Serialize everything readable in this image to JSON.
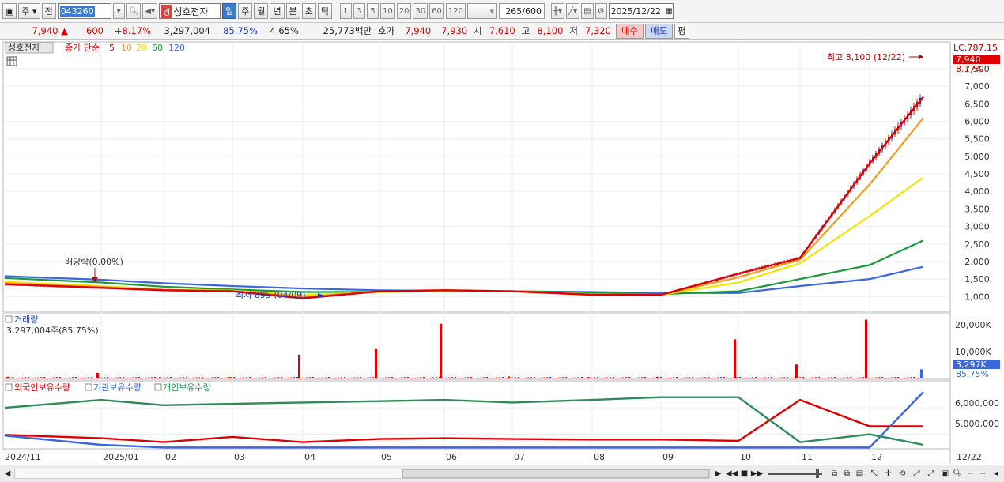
{
  "toolbar": {
    "market": "주",
    "period_type": "전",
    "code": "043260",
    "stock_badge": "경",
    "stock_name": "성호전자",
    "intervals": [
      "일",
      "주",
      "월",
      "년",
      "분",
      "초",
      "틱"
    ],
    "active_interval": "일",
    "ticks": [
      "1",
      "3",
      "5",
      "10",
      "20",
      "30",
      "60",
      "120"
    ],
    "count_value": "265",
    "count_total": "/600",
    "date": "2025/12/22"
  },
  "quote": {
    "price": "7,940",
    "arrow": "▲",
    "change": "600",
    "change_pct": "+8.17%",
    "volume": "3,297,004",
    "vol_ratio": "85.75%",
    "turnover": "4.65%",
    "amount": "25,773백만",
    "ask_label": "호가",
    "ask1": "7,940",
    "ask2": "7,930",
    "open_label": "시",
    "open": "7,610",
    "high_label": "고",
    "high": "8,100",
    "low_label": "저",
    "low": "7,320",
    "buy_label": "매수",
    "sell_label": "매도",
    "even_label": "평"
  },
  "price_panel": {
    "legend_name": "성호전자",
    "ma_label": "종가 단순",
    "ma_periods": [
      "5",
      "10",
      "20",
      "60",
      "120"
    ],
    "ma_colors": [
      "#e00000",
      "#f59a1a",
      "#f2e600",
      "#1a9a3a",
      "#3a66e0"
    ],
    "lc_label": "LC:787.15",
    "current_price_tag": "7,940",
    "current_pct": "8.17%",
    "high_annotation": "최고 8,100 (12/22)",
    "low_annotation": "최저 895 (04/09)",
    "dividend_annotation": "배당락(0.00%)",
    "y_ticks": [
      "7,500",
      "7,000",
      "6,500",
      "6,000",
      "5,500",
      "5,000",
      "4,500",
      "4,000",
      "3,500",
      "3,000",
      "2,500",
      "2,000",
      "1,500",
      "1,000"
    ]
  },
  "volume_panel": {
    "title": "거래량",
    "subtitle": "3,297,004주(85.75%)",
    "y_ticks": [
      "20,000K",
      "10,000K"
    ],
    "tag": "3,297K",
    "tag_pct": "85.75%"
  },
  "holdings_panel": {
    "series": [
      "외국인보유수량",
      "기관보유수량",
      "개인보유수량"
    ],
    "colors": [
      "#e00000",
      "#3a66e0",
      "#2e8b57"
    ],
    "y_ticks": [
      "6,000,000",
      "5,000,000"
    ]
  },
  "x_axis": [
    "2024/11",
    "2025/01",
    "02",
    "03",
    "04",
    "05",
    "06",
    "07",
    "08",
    "09",
    "10",
    "11",
    "12",
    "12/22"
  ],
  "chart_data": [
    {
      "type": "line",
      "title": "성호전자",
      "ylim": [
        600,
        8200
      ],
      "x": [
        "2024/11",
        "2025/01",
        "02",
        "03",
        "04",
        "05",
        "06",
        "07",
        "08",
        "09",
        "10",
        "11",
        "12",
        "12/22"
      ],
      "series": [
        {
          "name": "5",
          "values": [
            1350,
            1250,
            1180,
            1150,
            950,
            1150,
            1180,
            1150,
            1050,
            1050,
            1650,
            2100,
            4800,
            6700
          ]
        },
        {
          "name": "10",
          "values": [
            1380,
            1270,
            1190,
            1160,
            990,
            1140,
            1180,
            1150,
            1060,
            1050,
            1550,
            2050,
            4200,
            6100
          ]
        },
        {
          "name": "20",
          "values": [
            1420,
            1300,
            1200,
            1170,
            1040,
            1130,
            1170,
            1150,
            1070,
            1050,
            1400,
            1950,
            3300,
            4400
          ]
        },
        {
          "name": "60",
          "values": [
            1530,
            1400,
            1280,
            1200,
            1130,
            1130,
            1150,
            1150,
            1110,
            1070,
            1150,
            1500,
            1900,
            2600
          ]
        },
        {
          "name": "120",
          "values": [
            1580,
            1480,
            1380,
            1300,
            1230,
            1180,
            1160,
            1150,
            1130,
            1100,
            1100,
            1300,
            1500,
            1850
          ]
        }
      ]
    },
    {
      "type": "bar",
      "title": "거래량",
      "ylim": [
        0,
        22000
      ],
      "categories": [
        "2024/11",
        "2025/01",
        "02",
        "03",
        "04",
        "05",
        "06",
        "07",
        "08",
        "09",
        "10",
        "11",
        "12",
        "12/22"
      ],
      "series": [
        {
          "name": "거래량",
          "values": [
            600,
            2000,
            500,
            500,
            8500,
            10500,
            19500,
            700,
            500,
            600,
            14000,
            5000,
            21000,
            3297
          ]
        }
      ]
    },
    {
      "type": "line",
      "x": [
        "2024/11",
        "2025/01",
        "02",
        "03",
        "04",
        "05",
        "06",
        "07",
        "08",
        "09",
        "10",
        "11",
        "12",
        "12/22"
      ],
      "series": [
        {
          "name": "외국인보유수량",
          "values": [
            4.98,
            4.85,
            4.7,
            4.9,
            4.7,
            4.82,
            4.85,
            4.82,
            4.8,
            4.8,
            4.75,
            6.3,
            5.3,
            5.3
          ]
        },
        {
          "name": "기관보유수량",
          "values": [
            4.95,
            4.6,
            4.5,
            4.5,
            4.5,
            4.5,
            4.5,
            4.5,
            4.5,
            4.5,
            4.5,
            4.5,
            4.5,
            6.6
          ]
        },
        {
          "name": "개인보유수량",
          "values": [
            6.0,
            6.3,
            6.1,
            6.15,
            6.2,
            6.25,
            6.3,
            6.2,
            6.3,
            6.4,
            6.4,
            4.7,
            5.0,
            4.6
          ]
        }
      ]
    }
  ]
}
